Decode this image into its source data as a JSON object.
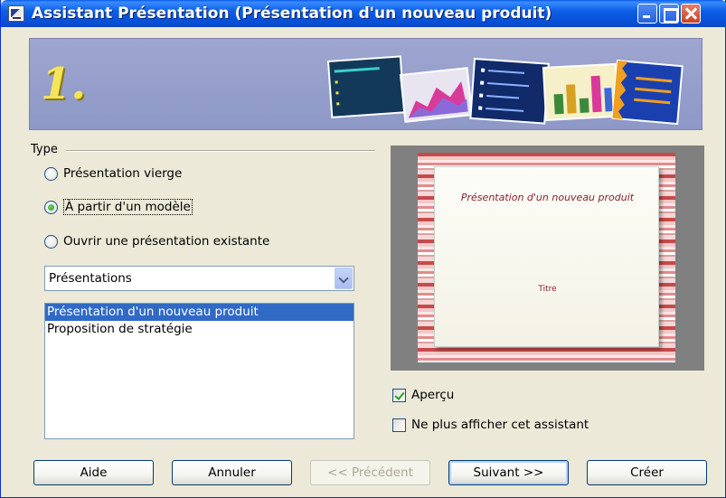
{
  "window": {
    "title": "Assistant Présentation (Présentation d'un nouveau produit)"
  },
  "banner": {
    "step_number": "1."
  },
  "type_group": {
    "label": "Type",
    "options": [
      {
        "label": "Présentation vierge",
        "selected": false
      },
      {
        "label": "À partir d'un modèle",
        "selected": true
      },
      {
        "label": "Ouvrir une présentation existante",
        "selected": false
      }
    ]
  },
  "category_select": {
    "value": "Présentations"
  },
  "template_list": {
    "items": [
      {
        "label": "Présentation d'un nouveau produit",
        "selected": true
      },
      {
        "label": "Proposition de stratégie",
        "selected": false
      }
    ]
  },
  "preview": {
    "slide_title": "Présentation d'un nouveau produit",
    "slide_subtitle": "Titre"
  },
  "options": {
    "preview_label": "Aperçu",
    "preview_checked": true,
    "no_show_label": "Ne plus afficher cet assistant",
    "no_show_checked": false
  },
  "buttons": {
    "help": "Aide",
    "cancel": "Annuler",
    "previous": "<< Précédent",
    "next": "Suivant >>",
    "create": "Créer"
  },
  "colors": {
    "titlebar": "#0a5ae8",
    "selection": "#316ac5",
    "background": "#ece9d8"
  }
}
